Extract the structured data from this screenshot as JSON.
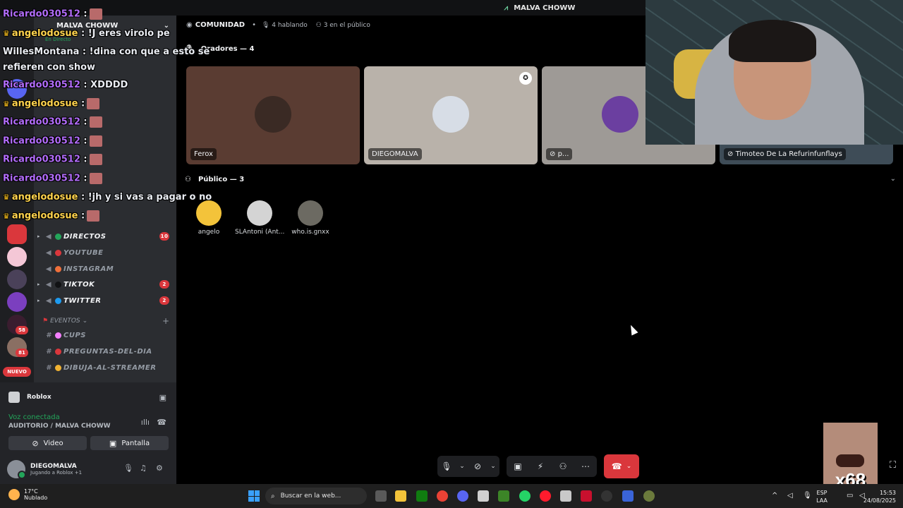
{
  "titlebar": {
    "title": "MALVA CHOWW"
  },
  "server": {
    "name": "MALVA CHOWW",
    "live_label": "En Directo"
  },
  "channels": {
    "directos": {
      "label": "DIRECTOS",
      "badge": "10",
      "dot": "#23a55a"
    },
    "youtube": {
      "label": "YOUTUBE",
      "dot": "#da373c"
    },
    "instagram": {
      "label": "INSTAGRAM",
      "dot": "#f0703b"
    },
    "tiktok": {
      "label": "TIKTOK",
      "badge": "2",
      "dot": "#111214"
    },
    "twitter": {
      "label": "TWITTER",
      "badge": "2",
      "dot": "#1d9bf0"
    },
    "eventos_cat": "EVENTOS",
    "cups": "CUPS",
    "preguntas": "PREGUNTAS-DEL-DIA",
    "dibuja": "DIBUJA-AL-STREAMER"
  },
  "rail_badges": {
    "b1": "58",
    "b2": "81"
  },
  "rail_nuevo": "NUEVO",
  "chat": [
    {
      "user": "angelodosue",
      "text": "!J eres virolo pe"
    },
    {
      "user": "WillesMontana",
      "text": "!dina con que a esto se"
    },
    {
      "user": "",
      "text": "refieren con show"
    },
    {
      "user": "Ricardo030512",
      "text": "XDDDD"
    },
    {
      "user": "angelodosue",
      "text": ""
    },
    {
      "user": "Ricardo030512",
      "text": ""
    },
    {
      "user": "Ricardo030512",
      "text": ""
    },
    {
      "user": "Ricardo030512",
      "text": ""
    },
    {
      "user": "Ricardo030512",
      "text": ""
    },
    {
      "user": "angelodosue",
      "text": "!jh y si vas a pagar o no"
    },
    {
      "user": "angelodosue",
      "text": ""
    }
  ],
  "chat_top": {
    "user": "Ricardo030512"
  },
  "panel": {
    "activity": "Roblox",
    "voice_status": "Voz conectada",
    "voice_location": "AUDITORIO / MALVA CHOWW",
    "video_btn": "Video",
    "screen_btn": "Pantalla",
    "username": "DIEGOMALVA",
    "user_activity": "Jugando a Roblox +1"
  },
  "stage": {
    "title": "COMUNIDAD",
    "speaking": "4 hablando",
    "audience": "3 en el público",
    "speakers_label": "Oradores — 4",
    "audience_label": "Público — 3",
    "speakers": [
      {
        "name": "Ferox",
        "bg": "#5a3c32"
      },
      {
        "name": "DIEGOMALVA",
        "bg": "#b9b2aa"
      },
      {
        "name": "p...",
        "bg": "#9e9a96"
      },
      {
        "name": "Timoteo De La Refurinfunflays",
        "bg": "#3e4c57"
      }
    ],
    "listeners": [
      {
        "name": "angelo"
      },
      {
        "name": "SLAntoni (Ant..."
      },
      {
        "name": "who.is.gnxx"
      }
    ]
  },
  "meme_text": "x68",
  "taskbar": {
    "temp": "17°C",
    "weather": "Nublado",
    "search": "Buscar en la web...",
    "lang1": "ESP",
    "lang2": "LAA",
    "time": "15:53",
    "date": "24/08/2025"
  }
}
